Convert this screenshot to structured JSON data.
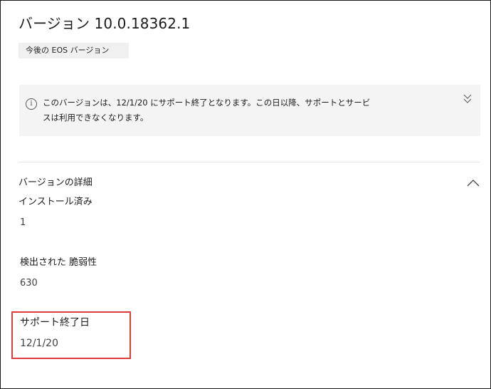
{
  "header": {
    "title": "バージョン 10.0.18362.1",
    "tag": "今後の EOS バージョン"
  },
  "notice": {
    "icon": "info-icon",
    "line1": "このバージョンは、12/1/20 にサポート終了となります。この日以降、サポートとサービ",
    "line2": "スは利用できなくなります。",
    "expand_icon": "chevron-double-down-icon"
  },
  "details": {
    "header": "バージョンの詳細",
    "collapse_icon": "chevron-up-icon",
    "fields": [
      {
        "label": "インストール済み",
        "value": "1"
      },
      {
        "label": "検出された 脆弱性",
        "value": "630"
      },
      {
        "label": "サポート終了日",
        "value": "12/1/20"
      }
    ]
  },
  "colors": {
    "highlight": "#e03c3c",
    "notice_bg": "#f4f4f4",
    "tag_bg": "#f0f0f0"
  }
}
